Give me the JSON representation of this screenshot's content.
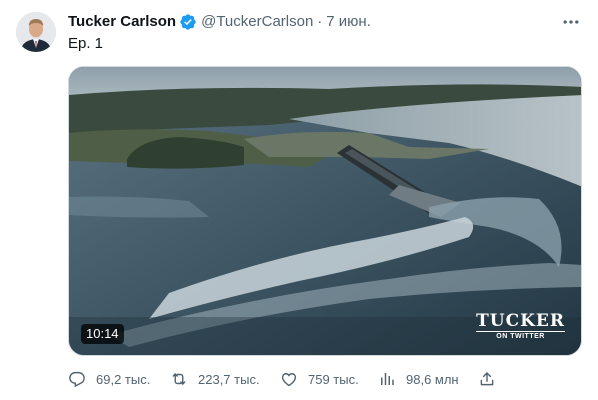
{
  "tweet": {
    "author_name": "Tucker Carlson",
    "handle": "@TuckerCarlson",
    "separator": "·",
    "date": "7 июн.",
    "text": "Ep. 1",
    "video": {
      "duration": "10:14",
      "watermark_main": "TUCKER",
      "watermark_sub": "ON TWITTER"
    },
    "actions": {
      "replies": "69,2 тыс.",
      "retweets": "223,7 тыс.",
      "likes": "759 тыс.",
      "views": "98,6 млн"
    }
  },
  "colors": {
    "text_primary": "#0f1419",
    "text_secondary": "#536471",
    "verified_blue": "#1d9bf0",
    "border": "#cfd9de"
  },
  "icons": [
    "verified-badge-icon",
    "more-options-icon",
    "reply-icon",
    "retweet-icon",
    "like-icon",
    "views-icon",
    "share-icon"
  ]
}
